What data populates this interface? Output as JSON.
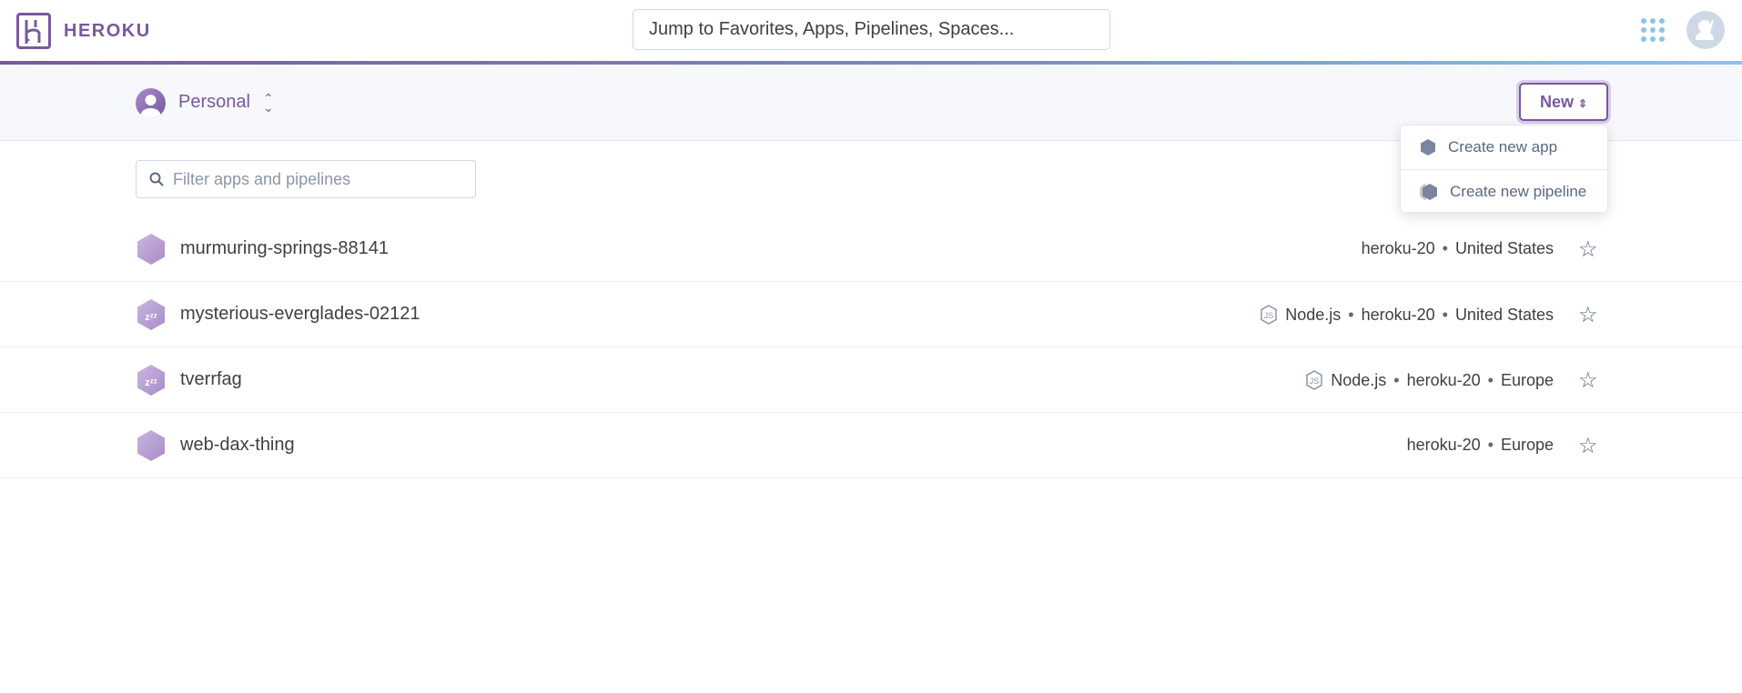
{
  "header": {
    "brand": "HEROKU",
    "search_placeholder": "Jump to Favorites, Apps, Pipelines, Spaces..."
  },
  "colors": {
    "brand": "#79589f",
    "accent_blue": "#8cc4e8"
  },
  "subheader": {
    "account": "Personal",
    "new_button": "New"
  },
  "new_menu": {
    "items": [
      {
        "label": "Create new app",
        "icon": "app-hexagon-icon"
      },
      {
        "label": "Create new pipeline",
        "icon": "pipeline-icon"
      }
    ]
  },
  "filter": {
    "placeholder": "Filter apps and pipelines",
    "value": ""
  },
  "apps": [
    {
      "name": "murmuring-springs-88141",
      "sleeping": false,
      "buildpack": "",
      "stack": "heroku-20",
      "region": "United States"
    },
    {
      "name": "mysterious-everglades-02121",
      "sleeping": true,
      "buildpack": "Node.js",
      "stack": "heroku-20",
      "region": "United States"
    },
    {
      "name": "tverrfag",
      "sleeping": true,
      "buildpack": "Node.js",
      "stack": "heroku-20",
      "region": "Europe"
    },
    {
      "name": "web-dax-thing",
      "sleeping": false,
      "buildpack": "",
      "stack": "heroku-20",
      "region": "Europe"
    }
  ],
  "separator": "•"
}
